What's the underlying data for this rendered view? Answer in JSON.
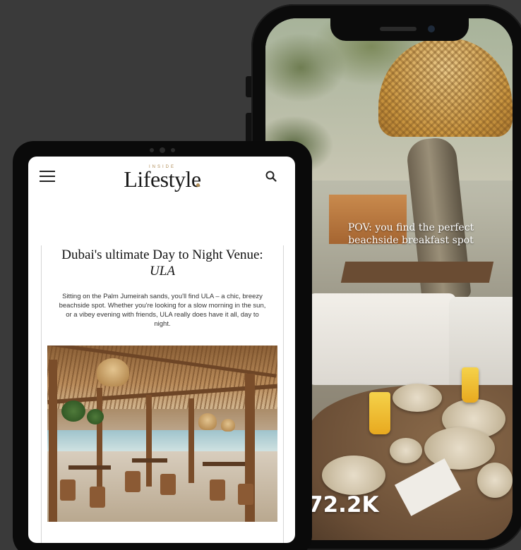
{
  "phone": {
    "video_caption": "POV: you find the perfect beachside breakfast spot",
    "view_count": "72.2K"
  },
  "tablet": {
    "site": {
      "logo_small": "INSIDE",
      "logo_main": "Lifestyle"
    },
    "article": {
      "headline_part1": "Dubai's ultimate Day to Night Venue: ",
      "headline_italic": "ULA",
      "intro": "Sitting on the Palm Jumeirah sands, you'll find ULA – a chic, breezy beachside spot. Whether you're looking for a slow morning in the sun, or a vibey evening with friends, ULA really does have it all, day to night."
    }
  },
  "icons": {
    "menu": "hamburger-menu-icon",
    "search": "search-icon"
  },
  "colors": {
    "background": "#3a3a3a",
    "logo_accent": "#b08d57",
    "device_frame": "#0b0b0b"
  }
}
